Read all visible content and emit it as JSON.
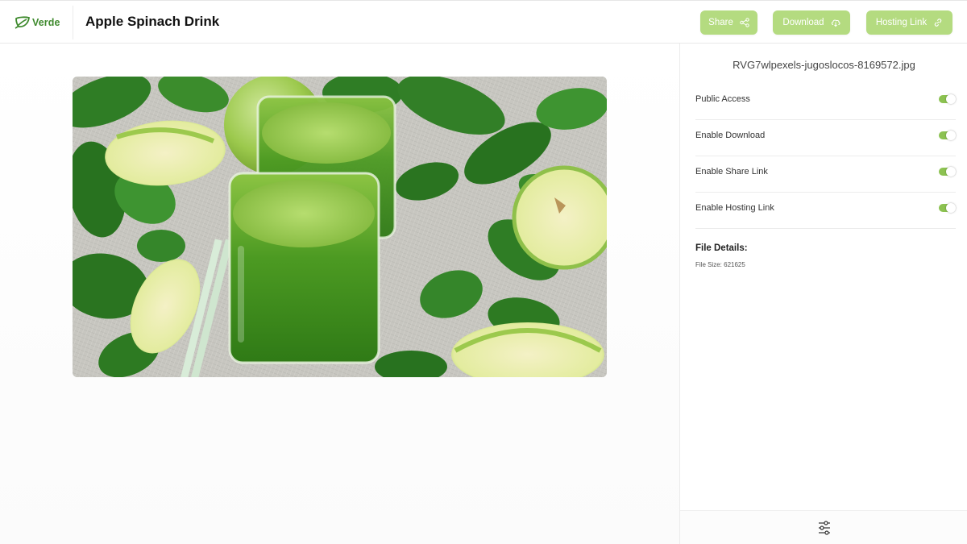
{
  "brand": {
    "name": "Verde",
    "accent": "#b4db80",
    "logo_color": "#3f8a2e"
  },
  "header": {
    "title": "Apple Spinach Drink",
    "buttons": {
      "share": {
        "label": "Share",
        "icon": "share-icon"
      },
      "download": {
        "label": "Download",
        "icon": "cloud-download-icon"
      },
      "hosting": {
        "label": "Hosting Link",
        "icon": "link-icon"
      }
    }
  },
  "preview": {
    "alt": "Green apple spinach juice in glasses with apples and spinach leaves"
  },
  "sidebar": {
    "file_name": "RVG7wlpexels-jugoslocos-8169572.jpg",
    "settings": [
      {
        "label": "Public Access",
        "enabled": true
      },
      {
        "label": "Enable Download",
        "enabled": true
      },
      {
        "label": "Enable Share Link",
        "enabled": true
      },
      {
        "label": "Enable Hosting Link",
        "enabled": true
      }
    ],
    "details_title": "File Details:",
    "file_size": "File Size: 621625",
    "footer_icon": "sliders-icon"
  }
}
